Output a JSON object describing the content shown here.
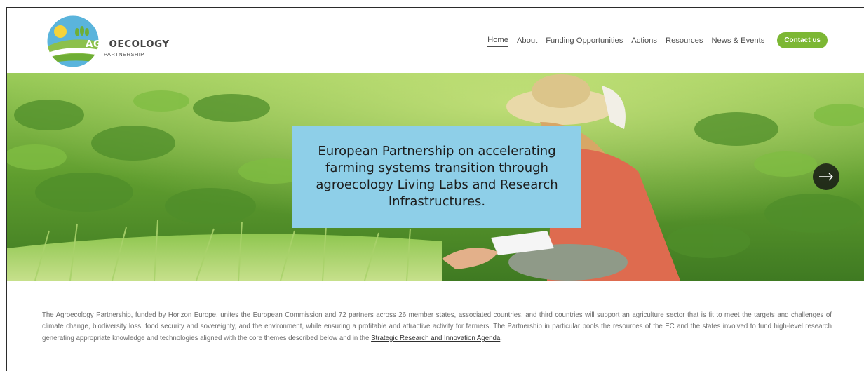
{
  "header": {
    "logo": {
      "word_part1": "AGR",
      "word_part2": "OECOLOGY",
      "subtitle": "PARTNERSHIP"
    },
    "nav": [
      {
        "label": "Home",
        "active": true
      },
      {
        "label": "About",
        "active": false
      },
      {
        "label": "Funding Opportunities",
        "active": false
      },
      {
        "label": "Actions",
        "active": false
      },
      {
        "label": "Resources",
        "active": false
      },
      {
        "label": "News & Events",
        "active": false
      }
    ],
    "contact_label": "Contact us"
  },
  "hero": {
    "title": "European Partnership on accelerating farming systems transition through agroecology Living Labs and Research Infrastructures.",
    "next_icon": "arrow-right-icon"
  },
  "intro": {
    "text": "The Agroecology Partnership, funded by Horizon Europe, unites the European Commission and 72 partners across 26 member states, associated countries, and third countries will support an agriculture sector that is fit to meet the targets and challenges of climate change, biodiversity loss, food security and sovereignty, and the environment, while ensuring a profitable and attractive activity for farmers. The Partnership in particular pools the resources of the EC and the states involved to fund high-level research generating appropriate knowledge and technologies aligned with the core themes described below and in the ",
    "link": "Strategic Research and Innovation Agenda",
    "end": "."
  },
  "colors": {
    "accent_green": "#7cb734",
    "hero_box": "#8ecfe8",
    "logo_blue": "#5ab4dc"
  }
}
